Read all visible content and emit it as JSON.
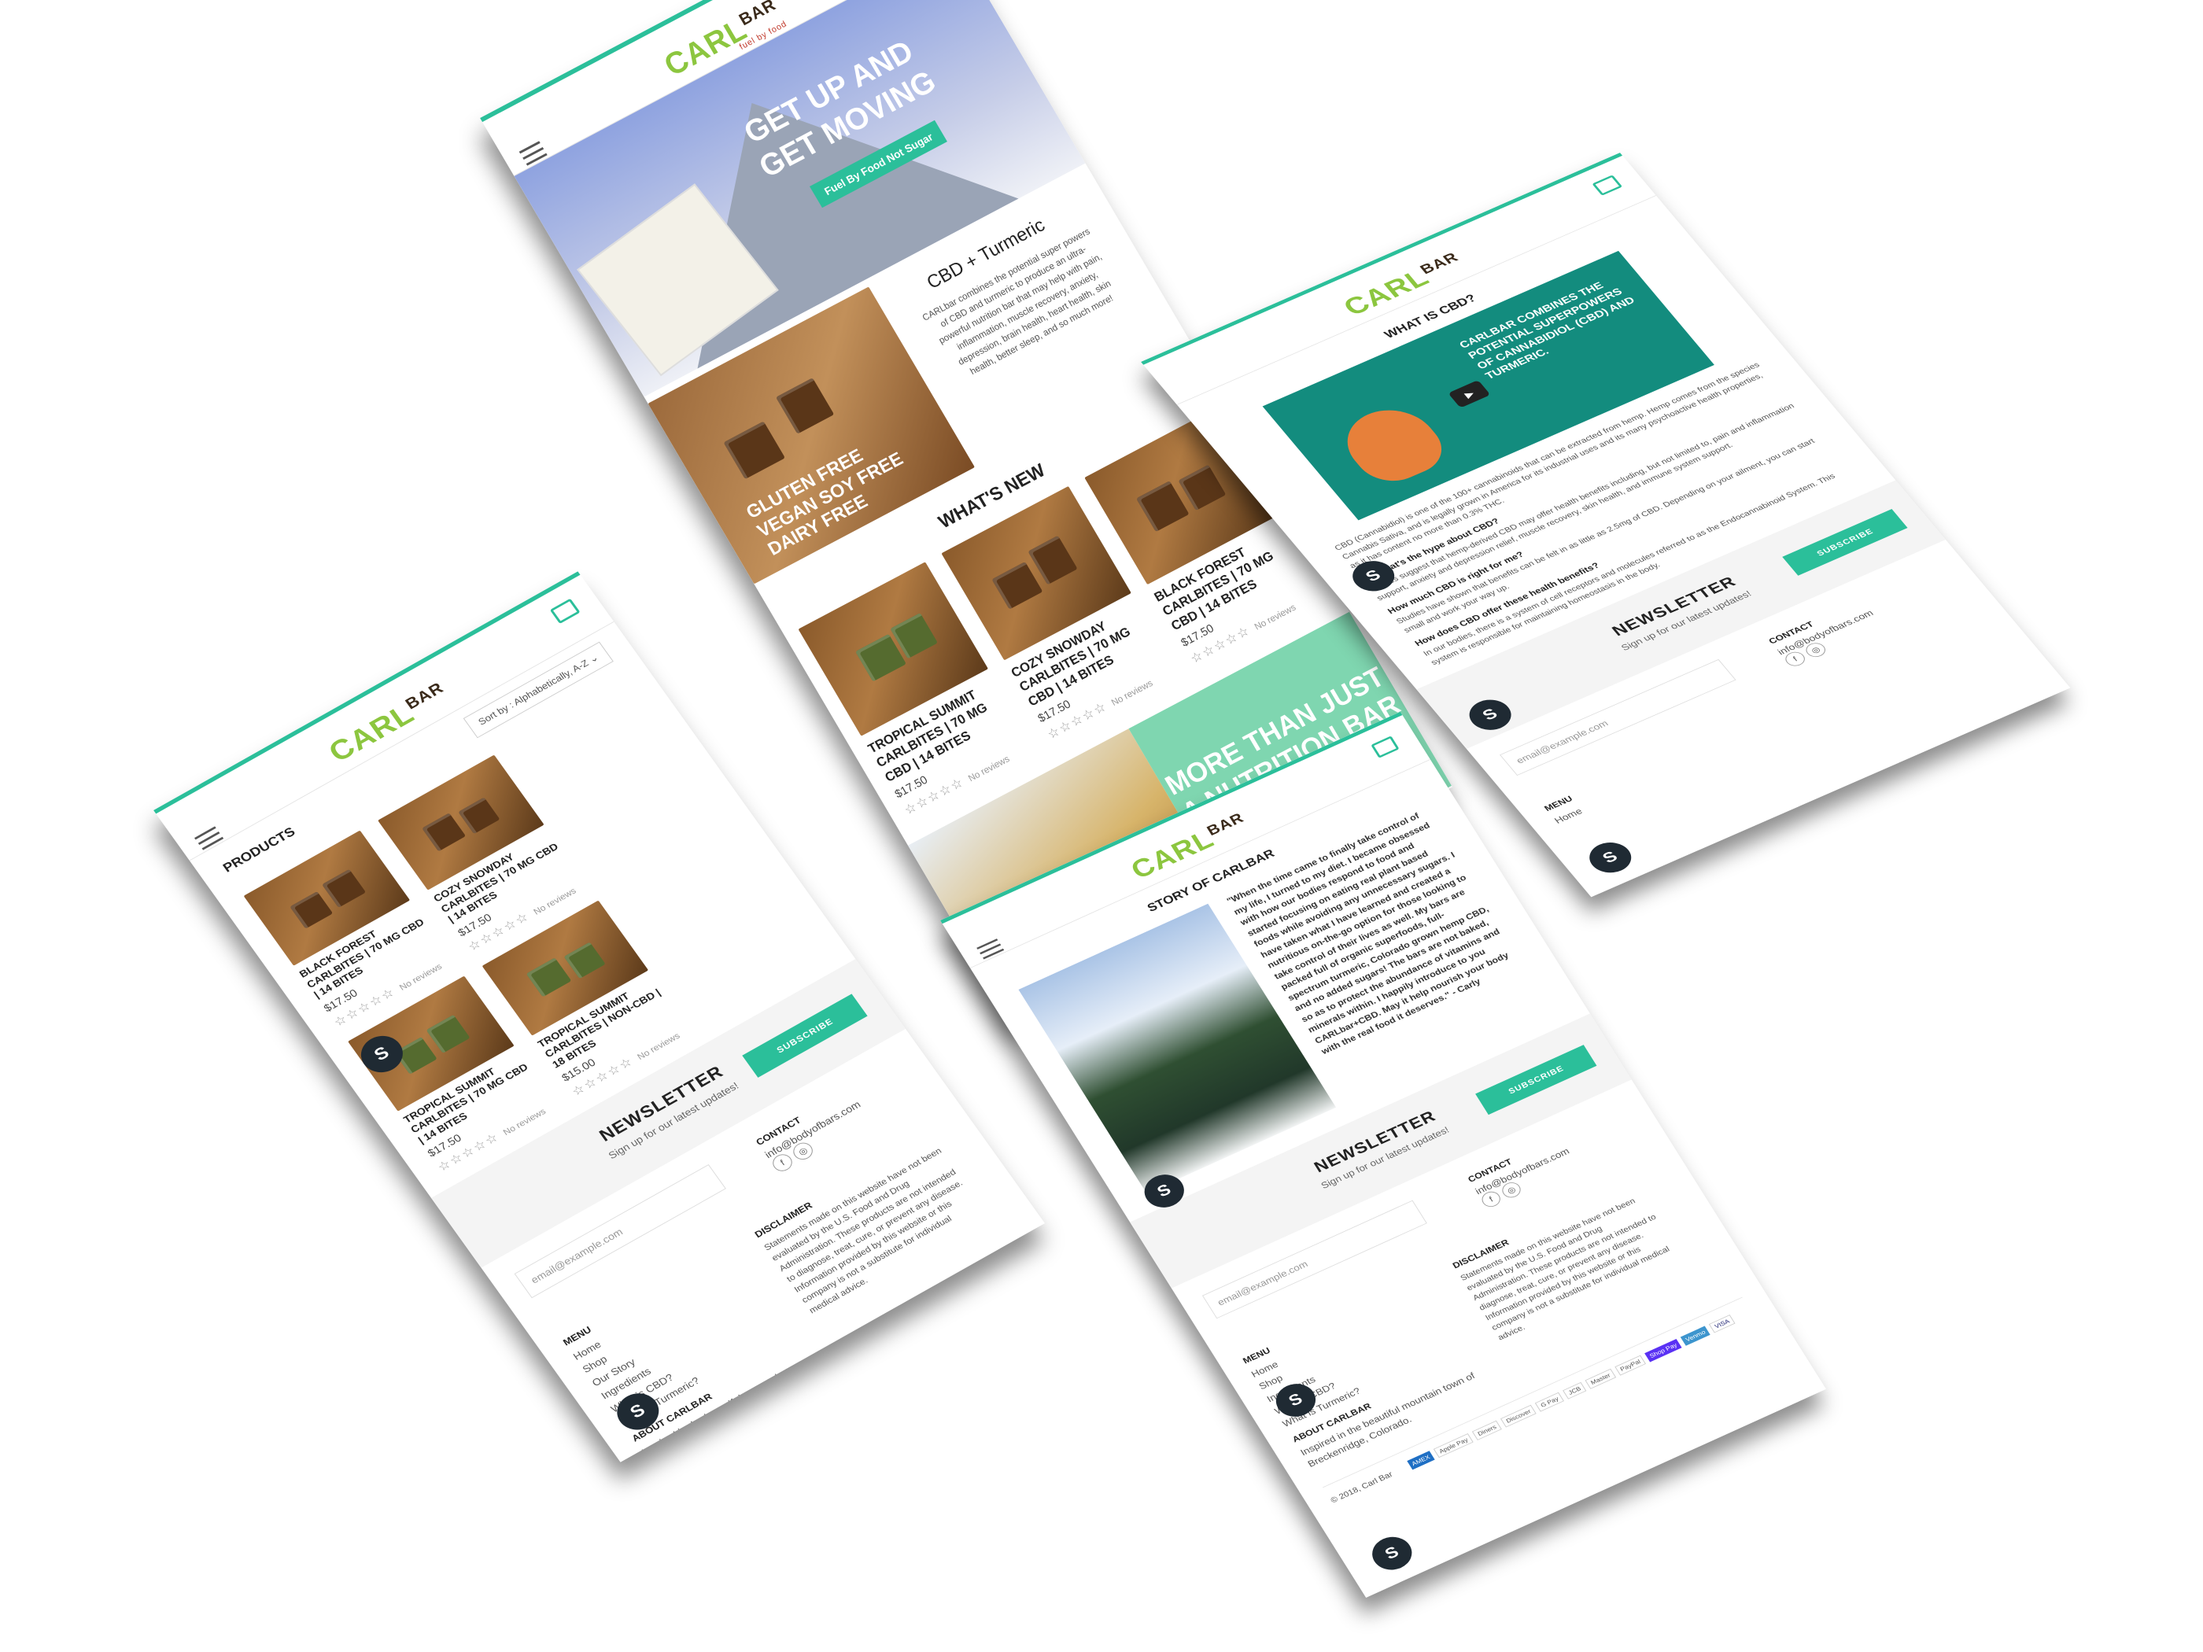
{
  "brand": {
    "logo_main": "CARL",
    "logo_bar": "BAR",
    "logo_sub": "fuel by food"
  },
  "home": {
    "hero_headline": "GET UP AND GET MOVING",
    "hero_button": "Fuel By Food Not Sugar",
    "cbd_title": "CBD + Turmeric",
    "cbd_text": "CARLbar combines the potential super powers of CBD and turmeric to produce an ultra-powerful nutrition bar that may help with pain, inflammation, muscle recovery, anxiety, depression, brain health, heart health, skin health, better sleep, and so much more!",
    "photo_caption": "GLUTEN FREE VEGAN SOY FREE DAIRY FREE",
    "whats_new": "WHAT'S NEW",
    "products": [
      {
        "name": "TROPICAL SUMMIT CARLBITES | 70 MG CBD | 14 BITES",
        "price": "$17.50",
        "reviews": "No reviews"
      },
      {
        "name": "COZY SNOWDAY CARLBITES | 70 MG CBD | 14 BITES",
        "price": "$17.50",
        "reviews": "No reviews"
      },
      {
        "name": "BLACK FOREST CARLBITES | 70 MG CBD | 14 BITES",
        "price": "$17.50",
        "reviews": "No reviews"
      }
    ],
    "promo": "MORE THAN JUST A NUTRITION BAR"
  },
  "products_page": {
    "title": "PRODUCTS",
    "sort_label": "Sort by",
    "sort_value": "Alphabetically, A-Z",
    "products": [
      {
        "name": "BLACK FOREST CARLBITES | 70 MG CBD | 14 BITES",
        "price": "$17.50",
        "reviews": "No reviews"
      },
      {
        "name": "COZY SNOWDAY CARLBITES | 70 MG CBD | 14 BITES",
        "price": "$17.50",
        "reviews": "No reviews"
      },
      {
        "name": "TROPICAL SUMMIT CARLBITES | 70 MG CBD | 14 BITES",
        "price": "$17.50",
        "reviews": "No reviews"
      },
      {
        "name": "TROPICAL SUMMIT CARLBITES | NON-CBD | 18 BITES",
        "price": "$15.00",
        "reviews": "No reviews"
      }
    ]
  },
  "cbd_page": {
    "title": "WHAT IS CBD?",
    "video_text": "CARLBAR COMBINES THE POTENTIAL SUPERPOWERS OF CANNABIDIOL (CBD) AND TURMERIC.",
    "intro": "CBD (Cannabidiol) is one of the 100+ cannabinoids that can be extracted from hemp. Hemp comes from the species Cannabis Sativa, and is legally grown in America for its industrial uses and its many psychoactive health properties, as it has content no more than 0.3% THC.",
    "q1": "So, what's the hype about CBD?",
    "a1": "Studies suggest that hemp-derived CBD may offer health benefits including, but not limited to, pain and inflammation support, anxiety and depression relief, muscle recovery, skin health, and immune system support.",
    "q2": "How much CBD is right for me?",
    "a2": "Studies have shown that benefits can be felt in as little as 2.5mg of CBD. Depending on your ailment, you can start small and work your way up.",
    "q3": "How does CBD offer these health benefits?",
    "a3": "In our bodies, there is a system of cell receptors and molecules referred to as the Endocannabinoid System. This system is responsible for maintaining homeostasis in the body."
  },
  "story_page": {
    "title": "STORY OF CARLBAR",
    "quote": "\"When the time came to finally take control of my life, I turned to my diet. I became obsessed with how our bodies respond to food and started focusing on eating real plant based foods while avoiding any unnecessary sugars. I have taken what I have learned and created a nutritious on-the-go option for those looking to take control of their lives as well. My bars are packed full of organic superfoods, full-spectrum turmeric, Colorado grown hemp CBD, and no added sugars! The bars are not baked, so as to protect the abundance of vitamins and minerals within. I happily introduce to you CARLbar+CBD. May it help nourish your body with the real food it deserves.\" - Carly"
  },
  "newsletter": {
    "title": "NEWSLETTER",
    "subtitle": "Sign up for our latest updates!",
    "button": "SUBSCRIBE",
    "email_placeholder": "email@example.com"
  },
  "footer": {
    "contact_label": "CONTACT",
    "contact_email": "info@bodyofbars.com",
    "menu_label": "MENU",
    "menu_items": [
      "Home",
      "Shop",
      "Our Story",
      "Ingredients",
      "What is CBD?",
      "What is Turmeric?"
    ],
    "disclaimer_label": "DISCLAIMER",
    "disclaimer": "Statements made on this website have not been evaluated by the U.S. Food and Drug Administration. These products are not intended to diagnose, treat, cure, or prevent any disease. Information provided by this website or this company is not a substitute for individual medical advice.",
    "about_label": "ABOUT CARLBAR",
    "about_text": "Inspired in the beautiful mountain town of Breckenridge, Colorado.",
    "copyright": "© 2018, Carl Bar",
    "payments": [
      "AMEX",
      "Apple Pay",
      "Diners",
      "Discover",
      "G Pay",
      "JCB",
      "Master",
      "PayPal",
      "Shop Pay",
      "Venmo",
      "VISA"
    ]
  },
  "icons": {
    "cart": "cart-icon",
    "menu": "hamburger-icon",
    "shopify": "shopify-bag-icon",
    "facebook": "facebook-icon",
    "instagram": "instagram-icon"
  },
  "colors": {
    "accent": "#2bbf9a",
    "brand_green": "#8cc63f",
    "hero_blue": "#8fa3e0",
    "promo_mint": "#7fd6b0",
    "video_teal": "#138c7e"
  }
}
